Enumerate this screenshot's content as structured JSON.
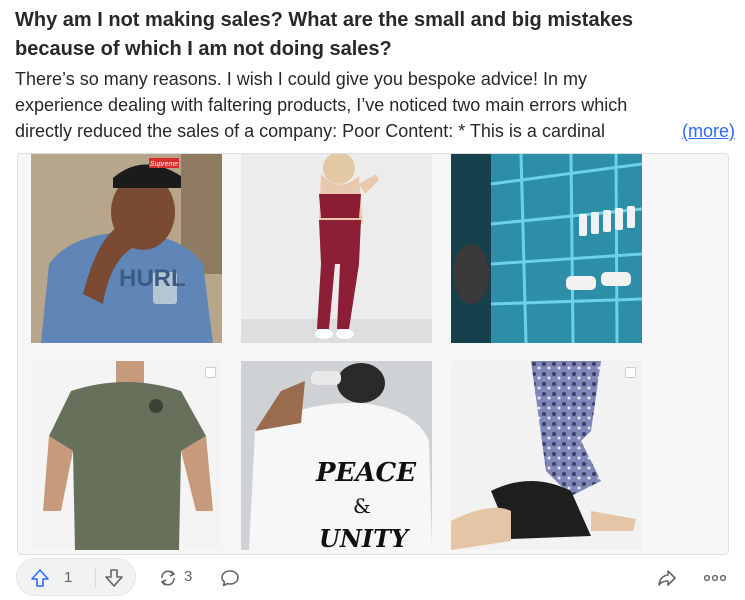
{
  "question": {
    "title": "Why am I not making sales? What are the small and big mistakes because of which I am not doing sales?"
  },
  "answer": {
    "excerpt_lines": [
      "There’s so many reasons. I wish I could give you bespoke advice! In my",
      "experience dealing with faltering products, I’ve noticed two main errors which",
      "directly reduced the sales of a company: Poor Content: * This is a cardinal"
    ],
    "more_label": "(more)"
  },
  "gallery": {
    "tile_1_cap": "Supreme",
    "tile_1_shirt": "HURL",
    "tile_5_shirt_line1": "PEACE",
    "tile_5_shirt_line2": "&",
    "tile_5_shirt_line3": "UNITY"
  },
  "actions": {
    "upvote_count": "1",
    "share_count": "3"
  },
  "colors": {
    "accent": "#2e69ff",
    "text": "#282829",
    "muted": "#636466"
  }
}
